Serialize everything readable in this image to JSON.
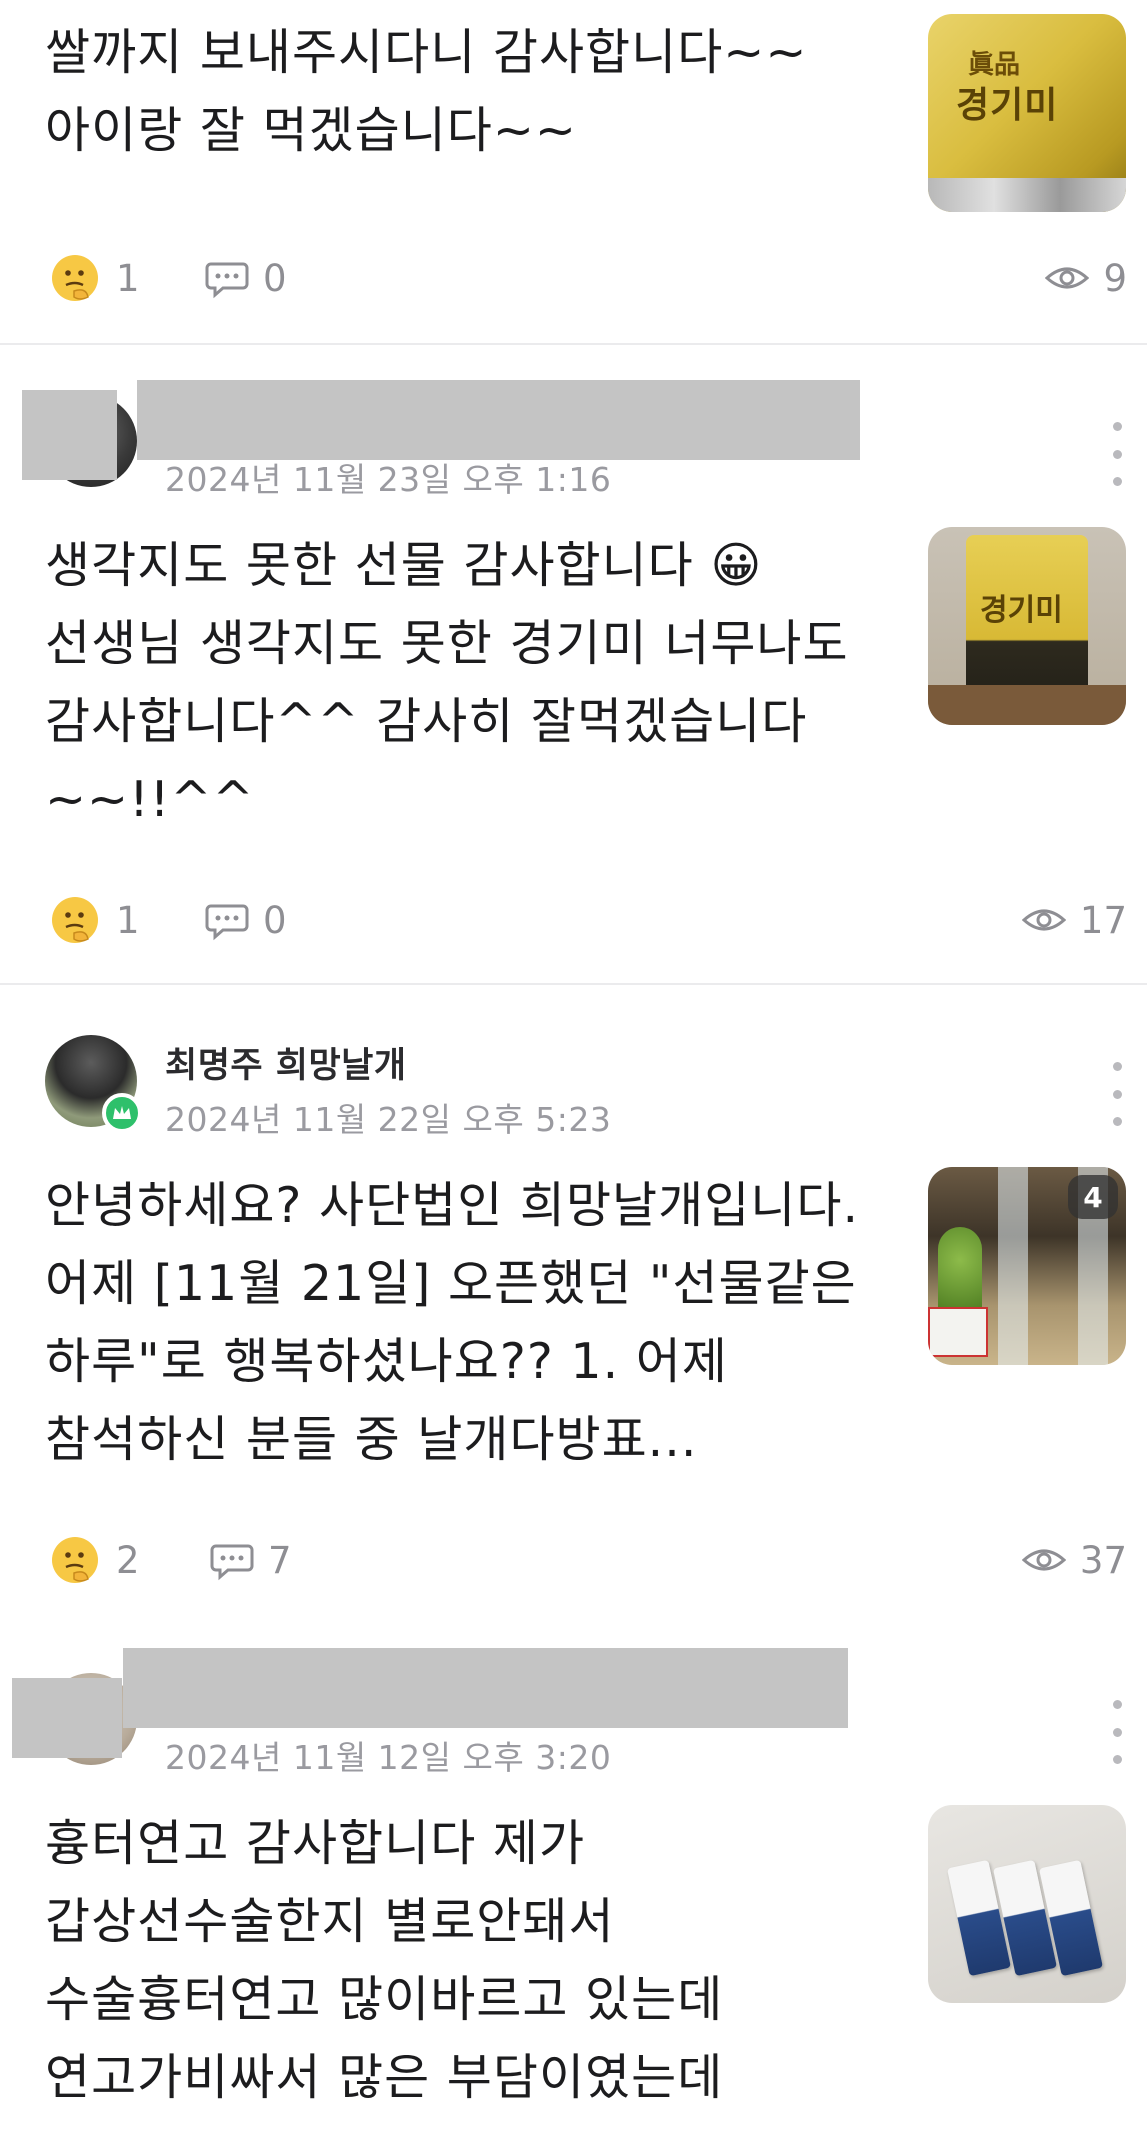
{
  "posts": [
    {
      "author": "",
      "timestamp": "",
      "text": "쌀까지 보내주시다니 감사합니다~~ 아이랑 잘 먹겠습니다~~",
      "thumbnail": "rice-bag",
      "thumbnail_label": "眞品 경기미",
      "reactions": "1",
      "comments": "0",
      "views": "9"
    },
    {
      "author": "",
      "timestamp": "2024년 11월 23일 오후 1:16",
      "text": "생각지도 못한 선물 감사합니다 😀 선생님 생각지도 못한 경기미 너무나도 감사합니다^^ 감사히 잘먹겠습니다~~!!^^",
      "thumbnail": "rice-bag",
      "thumbnail_label": "眞品 경기미",
      "reactions": "1",
      "comments": "0",
      "views": "17"
    },
    {
      "author": "최명주 희망날개",
      "timestamp": "2024년 11월 22일 오후 5:23",
      "text": "안녕하세요? 사단법인 희망날개입니다. 어제 [11월 21일] 오픈했던 \"선물같은 하루\"로 행복하셨나요?? 1. 어제 참석하신 분들 중 날개다방표...",
      "thumbnail": "store",
      "photo_count": "4",
      "reactions": "2",
      "comments": "7",
      "views": "37"
    },
    {
      "author": "",
      "timestamp": "2024년 11월 12일 오후 3:20",
      "text": "흉터연고 감사합니다 제가 갑상선수술한지 별로안돼서 수술흉터연고 많이바르고 있는데 연고가비싸서 많은 부담이였는데 이리많이 보내주셔…",
      "thumbnail": "ointment"
    }
  ],
  "icons": {
    "reaction": "thinking-face-emoji-icon",
    "comment": "speech-bubble-icon",
    "views": "eye-icon",
    "more": "vertical-ellipsis-icon",
    "badge": "crown-badge-icon"
  },
  "colors": {
    "text_primary": "#1c1c1e",
    "text_secondary": "#9a9aa0",
    "stat_gray": "#8e8e93",
    "divider": "#ebebed",
    "badge_green": "#2ec06b",
    "redaction": "#c4c4c4"
  }
}
